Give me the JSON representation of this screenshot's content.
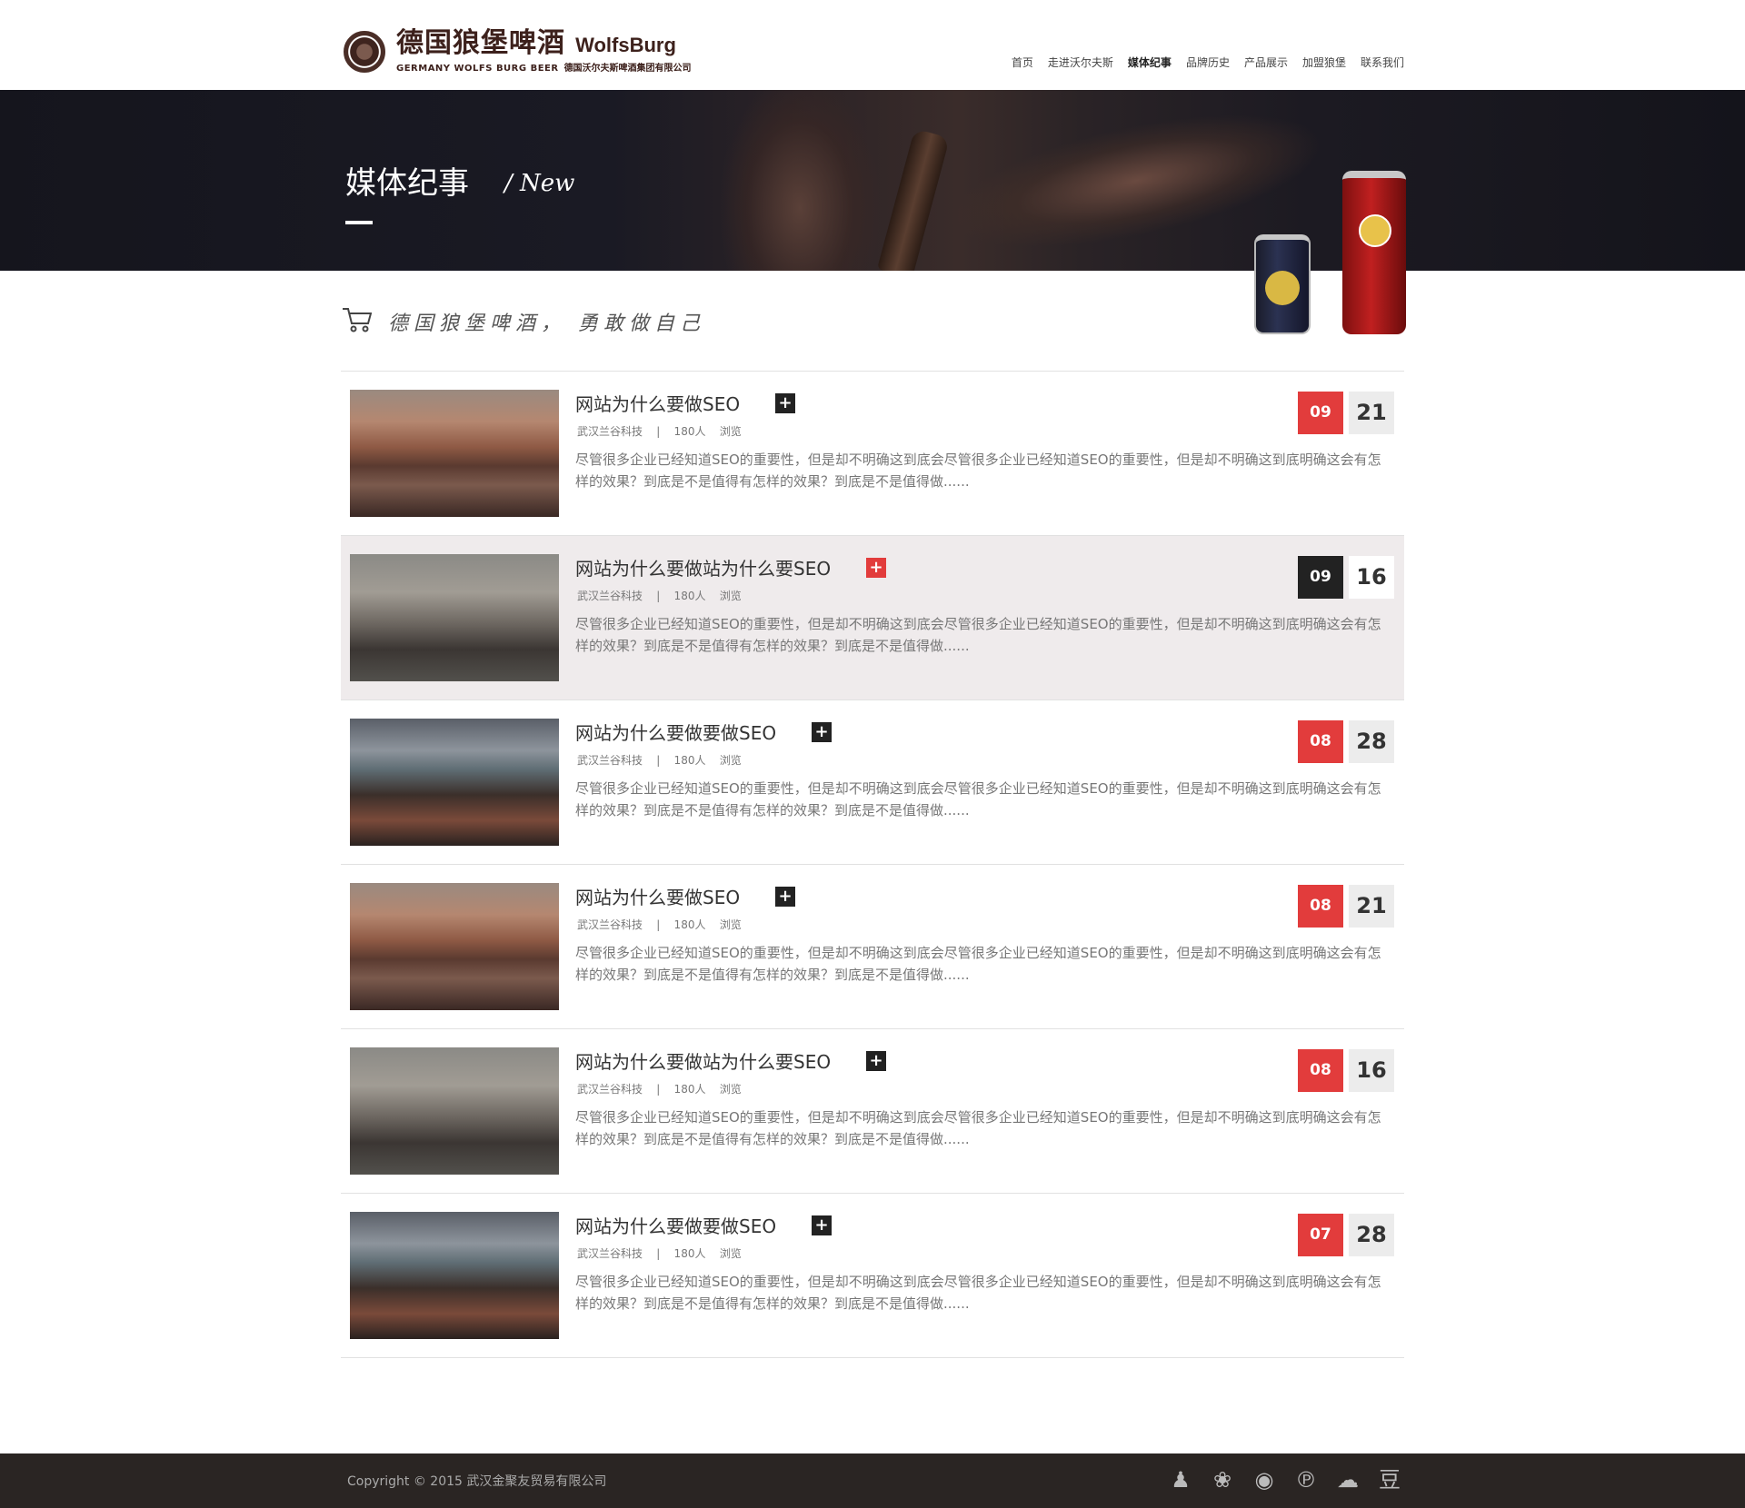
{
  "header": {
    "logo_cn": "德国狼堡啤酒",
    "logo_en": "WolfsBurg",
    "logo_sub_en": "GERMANY WOLFS BURG BEER",
    "logo_sub_cn": "德国沃尔夫斯啤酒集团有限公司",
    "nav": [
      {
        "label": "首页"
      },
      {
        "label": "走进沃尔夫斯"
      },
      {
        "label": "媒体纪事"
      },
      {
        "label": "品牌历史"
      },
      {
        "label": "产品展示"
      },
      {
        "label": "加盟狼堡"
      },
      {
        "label": "联系我们"
      }
    ]
  },
  "banner": {
    "title": "媒体纪事",
    "subtitle": "/ New"
  },
  "slogan": "德国狼堡啤酒， 勇敢做自己",
  "articles": [
    {
      "title": "网站为什么要做SEO",
      "meta": "武汉兰谷科技    |    180人    浏览",
      "excerpt": "尽管很多企业已经知道SEO的重要性，但是却不明确这到底会尽管很多企业已经知道SEO的重要性，但是却不明确这到底明确这会有怎样的效果？到底是不是值得有怎样的效果？到底是不是值得做......",
      "month": "09",
      "day": "21"
    },
    {
      "title": "网站为什么要做站为什么要SEO",
      "meta": "武汉兰谷科技    |    180人    浏览",
      "excerpt": "尽管很多企业已经知道SEO的重要性，但是却不明确这到底会尽管很多企业已经知道SEO的重要性，但是却不明确这到底明确这会有怎样的效果？到底是不是值得有怎样的效果？到底是不是值得做......",
      "month": "09",
      "day": "16"
    },
    {
      "title": "网站为什么要做要做SEO",
      "meta": "武汉兰谷科技    |    180人    浏览",
      "excerpt": "尽管很多企业已经知道SEO的重要性，但是却不明确这到底会尽管很多企业已经知道SEO的重要性，但是却不明确这到底明确这会有怎样的效果？到底是不是值得有怎样的效果？到底是不是值得做......",
      "month": "08",
      "day": "28"
    },
    {
      "title": "网站为什么要做SEO",
      "meta": "武汉兰谷科技    |    180人    浏览",
      "excerpt": "尽管很多企业已经知道SEO的重要性，但是却不明确这到底会尽管很多企业已经知道SEO的重要性，但是却不明确这到底明确这会有怎样的效果？到底是不是值得有怎样的效果？到底是不是值得做......",
      "month": "08",
      "day": "21"
    },
    {
      "title": "网站为什么要做站为什么要SEO",
      "meta": "武汉兰谷科技    |    180人    浏览",
      "excerpt": "尽管很多企业已经知道SEO的重要性，但是却不明确这到底会尽管很多企业已经知道SEO的重要性，但是却不明确这到底明确这会有怎样的效果？到底是不是值得有怎样的效果？到底是不是值得做......",
      "month": "08",
      "day": "16"
    },
    {
      "title": "网站为什么要做要做SEO",
      "meta": "武汉兰谷科技    |    180人    浏览",
      "excerpt": "尽管很多企业已经知道SEO的重要性，但是却不明确这到底会尽管很多企业已经知道SEO的重要性，但是却不明确这到底明确这会有怎样的效果？到底是不是值得有怎样的效果？到底是不是值得做......",
      "month": "07",
      "day": "28"
    }
  ],
  "footer": {
    "copyright": "Copyright © 2015   武汉金聚友贸易有限公司",
    "social": [
      {
        "icon": "qq-icon",
        "glyph": "♟"
      },
      {
        "icon": "baidu-icon",
        "glyph": "❀"
      },
      {
        "icon": "weibo-icon",
        "glyph": "◉"
      },
      {
        "icon": "pinterest-icon",
        "glyph": "℗"
      },
      {
        "icon": "wechat-icon",
        "glyph": "☁"
      },
      {
        "icon": "douban-icon",
        "glyph": "豆"
      }
    ]
  },
  "colors": {
    "accent": "#e23c3c",
    "dark": "#222222",
    "footer": "#2a2523"
  }
}
